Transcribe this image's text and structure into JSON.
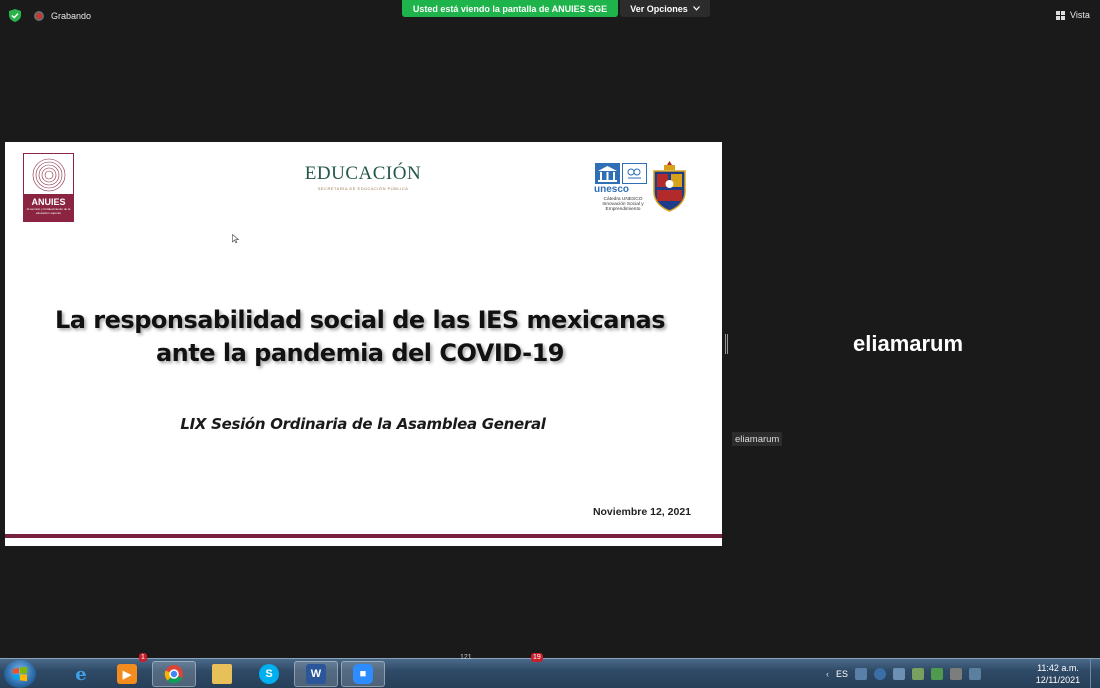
{
  "topbar": {
    "recording_label": "Grabando",
    "share_banner": "Usted está viendo la pantalla de ANUIES SGE",
    "view_options_label": "Ver Opciones",
    "view_label": "Vista"
  },
  "slide": {
    "logos": {
      "anuies_name": "ANUIES",
      "anuies_tagline": "Al servicio y fortalecimiento de la educación superior",
      "educacion_name": "EDUCACIÓN",
      "educacion_subtitle": "SECRETARÍA DE EDUCACIÓN PÚBLICA",
      "unesco_name": "unesco",
      "unesco_chair": "Cátedra UNESCO Innovación Social y Emprendimiento"
    },
    "title_line1": "La responsabilidad social de las IES mexicanas",
    "title_line2": "ante la pandemia del COVID-19",
    "subtitle": "LIX Sesión Ordinaria de la Asamblea General",
    "date": "Noviembre 12, 2021"
  },
  "participant": {
    "name": "eliamarum",
    "tag": "eliamarum"
  },
  "taskbar": {
    "apps": [
      "start-icon",
      "ie-icon",
      "media-player-icon",
      "chrome-icon",
      "file-explorer-icon",
      "skype-icon",
      "word-icon",
      "zoom-icon"
    ],
    "language": "ES",
    "time": "11:42 a.m.",
    "date": "12/11/2021",
    "badges": {
      "media": "1",
      "tray": "19",
      "counter": "121"
    }
  },
  "colors": {
    "share_banner": "#1fb34b",
    "anuies_maroon": "#8a2440",
    "educacion_green": "#24574a",
    "unesco_blue": "#2e6fb5",
    "taskbar": "#2f4a66"
  }
}
